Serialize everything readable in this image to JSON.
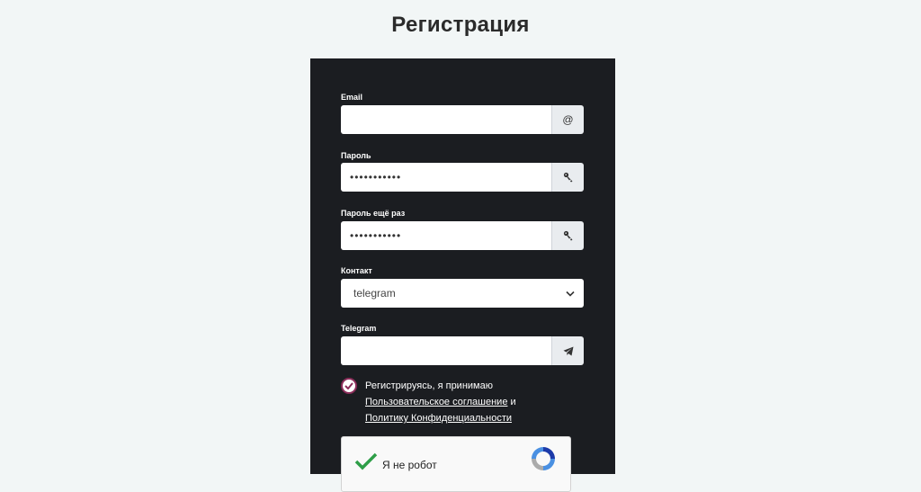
{
  "page": {
    "title": "Регистрация"
  },
  "form": {
    "email": {
      "label": "Email",
      "value": "",
      "addon": "@"
    },
    "password": {
      "label": "Пароль",
      "value": "•••••••••••"
    },
    "password_repeat": {
      "label": "Пароль ещё раз",
      "value": "•••••••••••"
    },
    "contact": {
      "label": "Контакт",
      "selected": "telegram"
    },
    "telegram": {
      "label": "Telegram",
      "value": ""
    },
    "agreement": {
      "text_before": "Регистрируясь, я принимаю",
      "link_terms": "Пользовательское соглашение",
      "connector": "и",
      "link_privacy": "Политику Конфиденциальности",
      "checked": true
    },
    "captcha": {
      "label": "Я не робот",
      "checked": true
    }
  },
  "colors": {
    "panel": "#1b1d21",
    "background": "#f2f6f6",
    "check_border": "#8b2d5a",
    "captcha_check": "#2e9e48"
  },
  "icons": {
    "email_addon": "at-icon",
    "password_addon": "key-icon",
    "password_repeat_addon": "key-icon",
    "telegram_addon": "paper-plane-icon",
    "contact_select": "chevron-down-icon",
    "agreement": "check-circle-icon",
    "captcha": "recaptcha-logo-icon"
  }
}
